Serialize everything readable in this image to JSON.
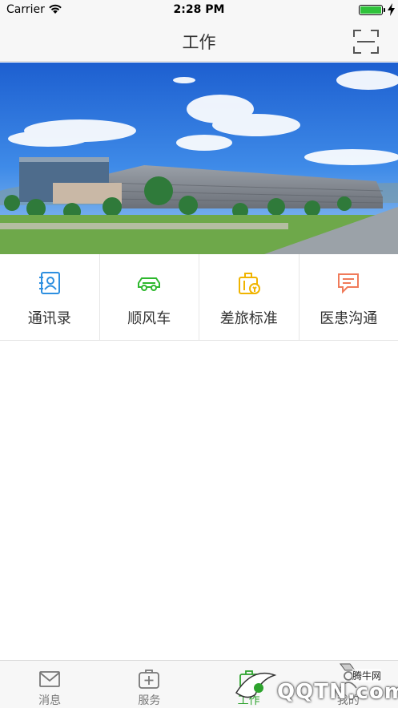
{
  "status_bar": {
    "carrier": "Carrier",
    "time": "2:28 PM"
  },
  "nav": {
    "title": "工作",
    "scan_icon": "scan-icon"
  },
  "banner": {
    "description_icon": "campus-photo"
  },
  "grid": [
    {
      "label": "通讯录",
      "icon": "contacts-icon",
      "color": "#2d8fe0"
    },
    {
      "label": "顺风车",
      "icon": "car-icon",
      "color": "#2eb82e"
    },
    {
      "label": "差旅标准",
      "icon": "luggage-icon",
      "color": "#f0b400"
    },
    {
      "label": "医患沟通",
      "icon": "chat-icon",
      "color": "#f07b5a"
    }
  ],
  "tabs": [
    {
      "label": "消息",
      "icon": "mail-icon",
      "active": false
    },
    {
      "label": "服务",
      "icon": "medical-kit-icon",
      "active": false
    },
    {
      "label": "工作",
      "icon": "work-icon",
      "active": true
    },
    {
      "label": "我的",
      "icon": "profile-icon",
      "active": false
    }
  ],
  "watermark": {
    "brand": "QQTN.com",
    "caption": "腾牛网"
  },
  "colors": {
    "active_tab": "#2ea32e",
    "bar_background": "#f7f7f7"
  }
}
